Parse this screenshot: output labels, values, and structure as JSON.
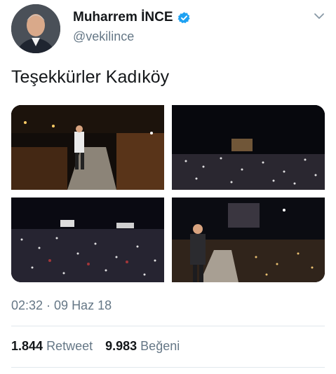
{
  "tweet": {
    "display_name": "Muharrem İNCE",
    "handle": "@vekilince",
    "text": "Teşekkürler Kadıköy",
    "timestamp": "02:32 · 09 Haz 18"
  },
  "stats": {
    "retweet_count": "1.844",
    "retweet_label": "Retweet",
    "like_count": "9.983",
    "like_label": "Beğeni"
  },
  "icons": {
    "verified": "verified-badge-icon",
    "more": "chevron-down-icon"
  },
  "colors": {
    "verified_blue": "#1da1f2",
    "text_primary": "#14171a",
    "text_secondary": "#657786",
    "divider": "#e1e8ed"
  }
}
